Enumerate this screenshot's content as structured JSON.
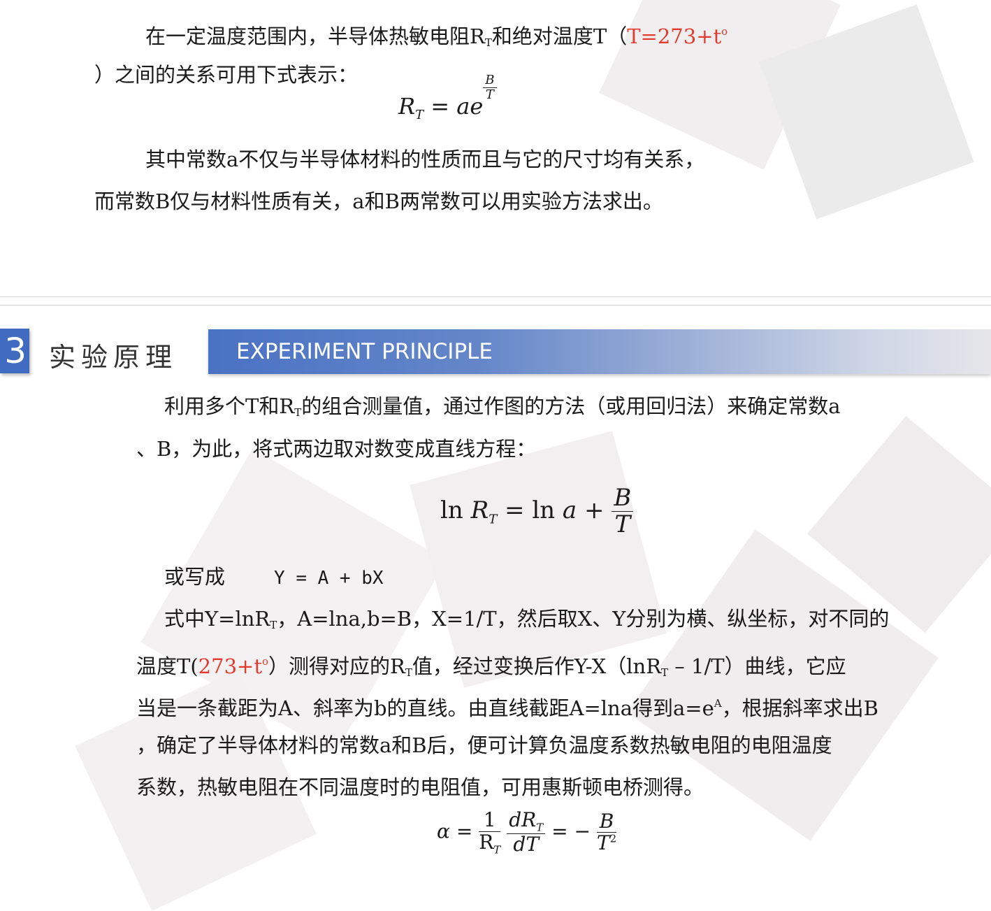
{
  "top": {
    "p1_a": "在一定温度范围内，半导体热敏电阻R",
    "p1_sub": "T",
    "p1_b": "和绝对温度T（",
    "p1_red": "T=273+t",
    "p1_red_sup": "o",
    "p2": "）之间的关系可用下式表示：",
    "eq1": {
      "lhs": "R",
      "lhs_sub": "T",
      "rhs": "= ae",
      "exp_num": "B",
      "exp_den": "T"
    },
    "p3": "其中常数a不仅与半导体材料的性质而且与它的尺寸均有关系，",
    "p4": "而常数B仅与材料性质有关，a和B两常数可以用实验方法求出。"
  },
  "section": {
    "number": "3",
    "title": "实验原理",
    "subtitle": "EXPERIMENT PRINCIPLE"
  },
  "body": {
    "l1_a": "利用多个T和R",
    "l1_sub": "T",
    "l1_b": "的组合测量值，通过作图的方法（或用回归法）来确定常数a",
    "l2": "、B，为此，将式两边取对数变成直线方程：",
    "eq2": {
      "ln1": "ln",
      "r": "R",
      "r_sub": "T",
      "mid": "= ln",
      "a": "a",
      "plus": "+",
      "num": "B",
      "den": "T"
    },
    "l3_label": "或写成",
    "l3_eq": "Y = A + bX",
    "l4_a": "式中Y=lnR",
    "l4_sub": "T",
    "l4_b": "，A=lna,b=B，X=1/T，然后取X、Y分别为横、纵坐标，对不同的",
    "l5_a": "温度T(",
    "l5_red": "273+t",
    "l5_red_sup": "o",
    "l5_b": "）测得对应的R",
    "l5_sub": "T",
    "l5_c": "值，经过变换后作Y-X（lnR",
    "l5_sub2": "T",
    "l5_d": " – 1/T）曲线，它应",
    "l6_a": "当是一条截距为A、斜率为b的直线。由直线截距A=lna得到a=e",
    "l6_sup": "A",
    "l6_b": "，根据斜率求出B",
    "l7": "，确定了半导体材料的常数a和B后，便可计算负温度系数热敏电阻的电阻温度",
    "l8": "系数，热敏电阻在不同温度时的电阻值，可用惠斯顿电桥测得。",
    "eq3": {
      "alpha": "α",
      "eq": "=",
      "f1_num": "1",
      "f1_den": "R",
      "f1_den_sub": "T",
      "f2_num": "dR",
      "f2_num_sub": "T",
      "f2_den": "dT",
      "eq2": "= −",
      "f3_num": "B",
      "f3_den": "T",
      "f3_den_sup": "2"
    }
  }
}
